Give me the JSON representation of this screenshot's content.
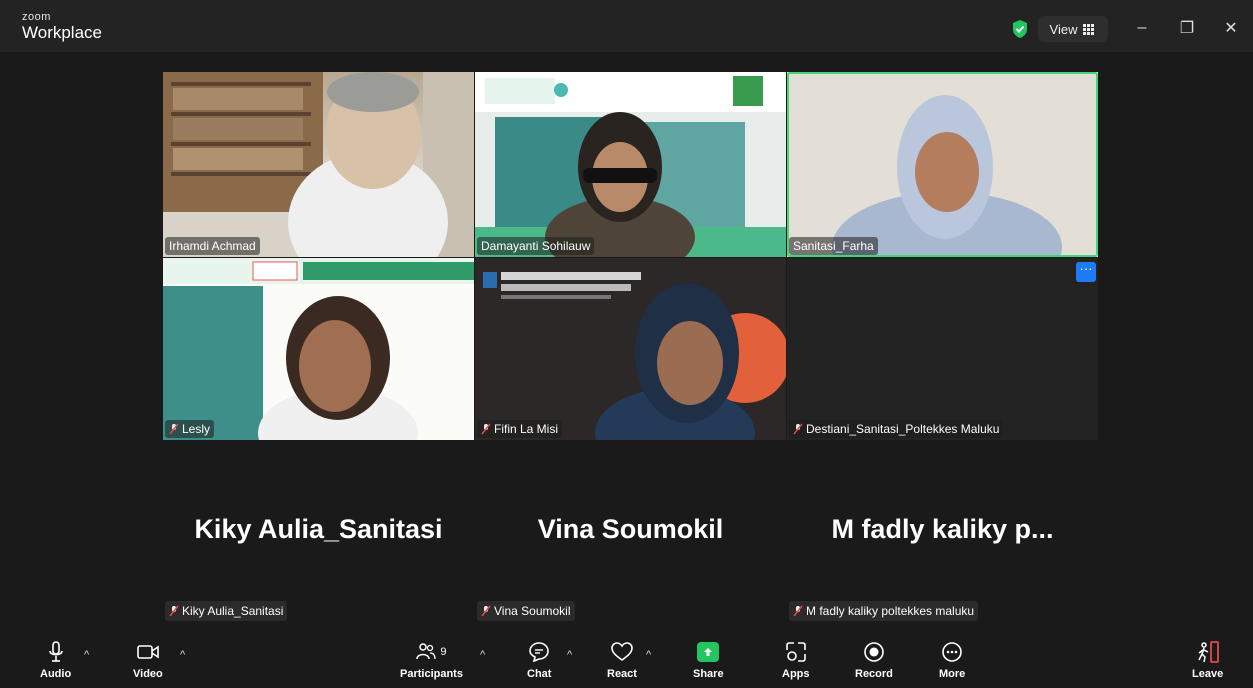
{
  "window": {
    "brand_small": "zoom",
    "brand_main": "Workplace",
    "view_label": "View",
    "minimize": "–",
    "restore": "❐",
    "close": "✕"
  },
  "colors": {
    "active_speaker": "#3fd77a",
    "share_green": "#22c55e",
    "more_blue": "#1f7bf5",
    "muted_red": "#e5484d"
  },
  "video_tiles": [
    {
      "name": "Irhamdi Achmad",
      "muted": false
    },
    {
      "name": "Damayanti Sohilauw",
      "muted": false
    },
    {
      "name": "Sanitasi_Farha",
      "muted": false,
      "active_speaker": true
    },
    {
      "name": "Lesly",
      "muted": true
    },
    {
      "name": "Fifin La Misi",
      "muted": true
    },
    {
      "name": "Destiani_Sanitasi_Poltekkes Maluku",
      "muted": true,
      "more_menu": "···"
    }
  ],
  "name_tiles": [
    {
      "display": "Kiky Aulia_Sanitasi",
      "label": "Kiky Aulia_Sanitasi"
    },
    {
      "display": "Vina Soumokil",
      "label": "Vina Soumokil"
    },
    {
      "display": "M fadly kaliky p...",
      "label": "M fadly kaliky poltekkes maluku"
    }
  ],
  "toolbar": {
    "audio": "Audio",
    "video": "Video",
    "participants": "Participants",
    "participants_count": "9",
    "chat": "Chat",
    "react": "React",
    "share": "Share",
    "apps": "Apps",
    "record": "Record",
    "more": "More",
    "leave": "Leave",
    "caret": "^"
  }
}
